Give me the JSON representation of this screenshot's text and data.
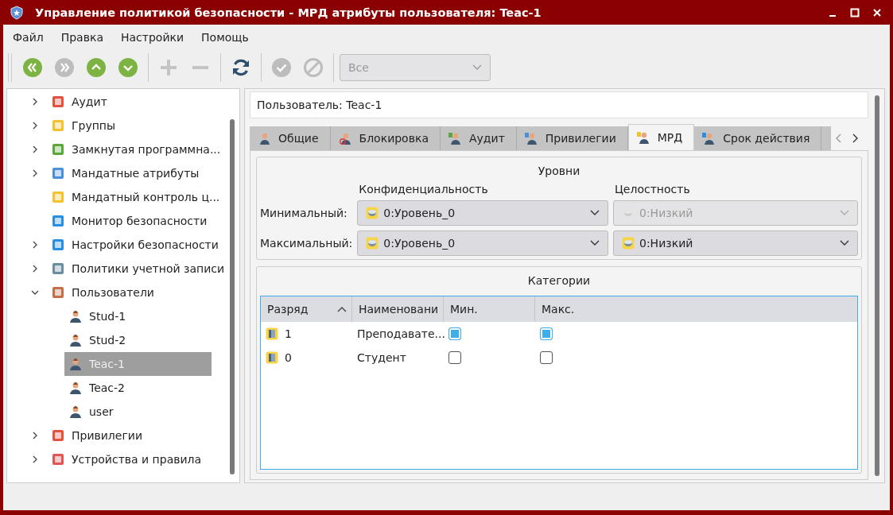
{
  "window": {
    "title": "Управление политикой безопасности - МРД атрибуты пользователя: Teac-1"
  },
  "menu": [
    "Файл",
    "Правка",
    "Настройки",
    "Помощь"
  ],
  "toolbar": {
    "buttons": [
      {
        "kind": "first",
        "disabled": false
      },
      {
        "kind": "next",
        "disabled": true
      },
      {
        "kind": "up",
        "disabled": false
      },
      {
        "kind": "down",
        "disabled": false
      },
      {
        "kind": "add",
        "disabled": true
      },
      {
        "kind": "remove",
        "disabled": true
      },
      {
        "kind": "refresh",
        "disabled": false
      },
      {
        "kind": "apply",
        "disabled": true
      },
      {
        "kind": "cancel",
        "disabled": true
      }
    ],
    "filter": {
      "value": "Все",
      "disabled": true
    }
  },
  "tree": [
    {
      "label": "Аудит",
      "expanded": false,
      "selected": false
    },
    {
      "label": "Группы",
      "expanded": false,
      "selected": false
    },
    {
      "label": "Замкнутая программна...",
      "expanded": false,
      "selected": false
    },
    {
      "label": "Мандатные атрибуты",
      "expanded": false,
      "selected": false
    },
    {
      "label": "Мандатный контроль ц...",
      "selected": false
    },
    {
      "label": "Монитор безопасности",
      "selected": false
    },
    {
      "label": "Настройки безопасности",
      "expanded": false,
      "selected": false
    },
    {
      "label": "Политики учетной записи",
      "expanded": false,
      "selected": false
    },
    {
      "label": "Пользователи",
      "expanded": true,
      "selected": false,
      "children": [
        {
          "label": "Stud-1",
          "selected": false
        },
        {
          "label": "Stud-2",
          "selected": false
        },
        {
          "label": "Teac-1",
          "selected": true
        },
        {
          "label": "Teac-2",
          "selected": false
        },
        {
          "label": "user",
          "selected": false
        }
      ]
    },
    {
      "label": "Привилегии",
      "expanded": false,
      "selected": false
    },
    {
      "label": "Устройства и правила",
      "expanded": false,
      "selected": false
    }
  ],
  "user_field": {
    "value": "Пользователь: Teac-1"
  },
  "tabs": [
    {
      "label": "Общие",
      "selected": false
    },
    {
      "label": "Блокировка",
      "selected": false
    },
    {
      "label": "Аудит",
      "selected": false
    },
    {
      "label": "Привилегии",
      "selected": false
    },
    {
      "label": "МРД",
      "selected": true
    },
    {
      "label": "Срок действия",
      "selected": false
    }
  ],
  "levels": {
    "title": "Уровни",
    "columns": [
      "Конфиденциальность",
      "Целостность"
    ],
    "rows": [
      {
        "label": "Минимальный:",
        "confidentiality": {
          "value": "0:Уровень_0",
          "disabled": false
        },
        "integrity": {
          "value": "0:Низкий",
          "disabled": true
        }
      },
      {
        "label": "Максимальный:",
        "confidentiality": {
          "value": "0:Уровень_0",
          "disabled": false
        },
        "integrity": {
          "value": "0:Низкий",
          "disabled": false
        }
      }
    ]
  },
  "categories": {
    "title": "Категории",
    "columns": [
      {
        "label": "Разряд",
        "sorted": true
      },
      {
        "label": "Наименовани",
        "sorted": false
      },
      {
        "label": "Мин.",
        "sorted": false
      },
      {
        "label": "Макс.",
        "sorted": false
      }
    ],
    "rows": [
      {
        "rank": "1",
        "name": "Преподавате...",
        "min": true,
        "max": true
      },
      {
        "rank": "0",
        "name": "Студент",
        "min": false,
        "max": false
      }
    ]
  }
}
